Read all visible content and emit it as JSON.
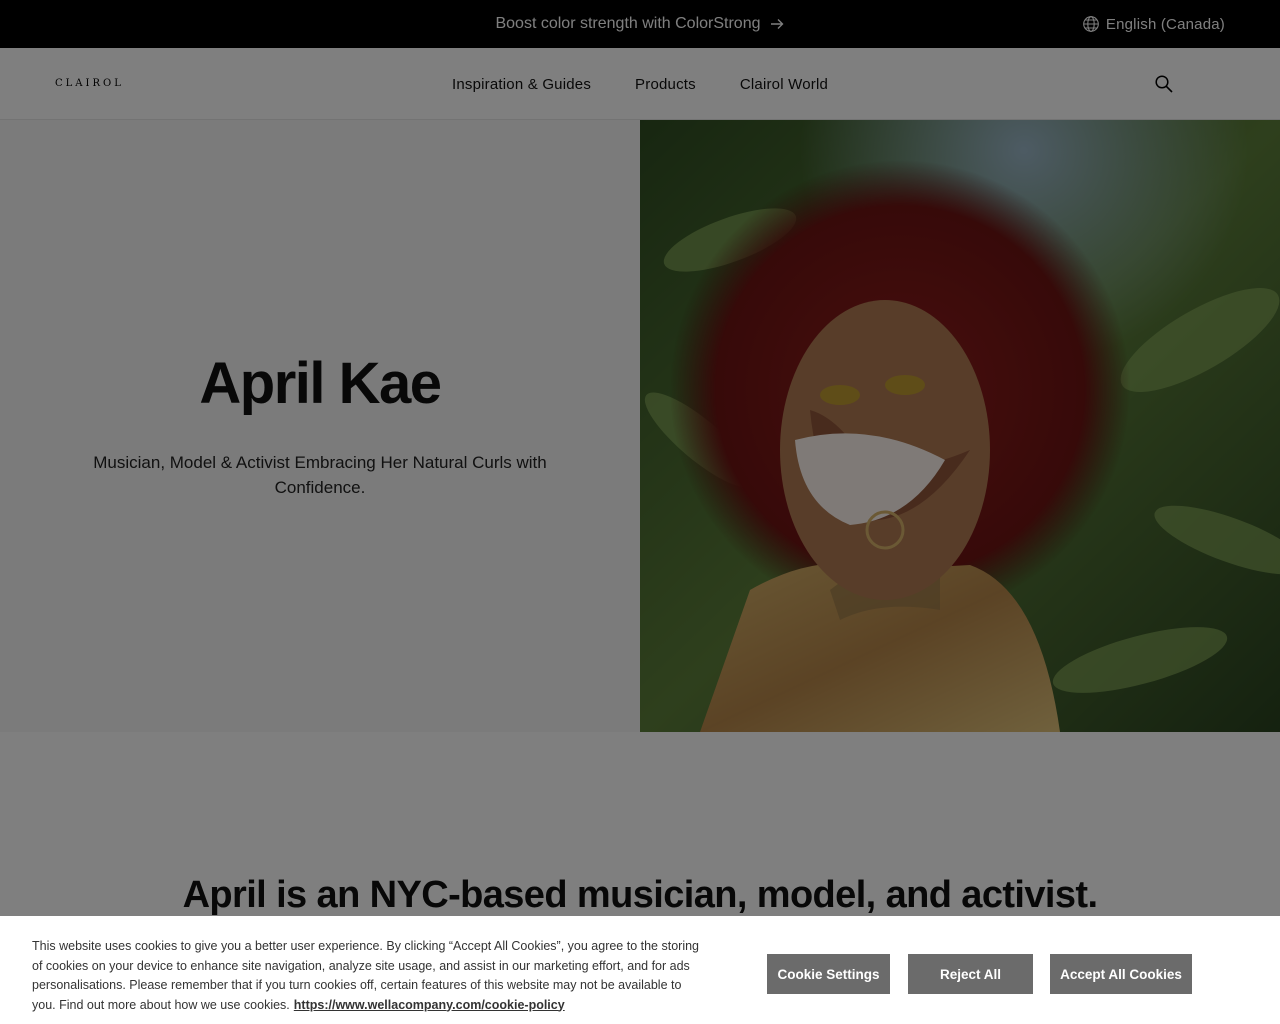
{
  "promo": {
    "text": "Boost color strength with ColorStrong"
  },
  "language": {
    "label": "English (Canada)"
  },
  "header": {
    "logo": "CLAIROL",
    "nav": [
      "Inspiration & Guides",
      "Products",
      "Clairol World"
    ]
  },
  "hero": {
    "title": "April Kae",
    "subtitle": "Musician, Model & Activist Embracing Her Natural Curls with Confidence."
  },
  "section": {
    "heading": "April is an NYC-based musician, model, and activist."
  },
  "cookie_banner": {
    "text": "This website uses cookies to give you a better user experience. By clicking “Accept All Cookies”, you agree to the storing of cookies on your device to enhance site navigation, analyze site usage, and assist in our marketing effort, and for ads personalisations. Please remember that if you turn cookies off, certain features of this website may not be available to you. Find out more about how we use cookies.",
    "link": "https://www.wellacompany.com/cookie-policy",
    "settings_label": "Cookie Settings",
    "reject_label": "Reject All",
    "accept_label": "Accept All Cookies"
  },
  "icons": {
    "promo_arrow": "arrow-right-icon",
    "language": "globe-icon",
    "search": "search-icon"
  },
  "colors": {
    "promo_bar": "#000000",
    "button": "#6b6b6b",
    "overlay": "rgba(0,0,0,0.5)"
  }
}
